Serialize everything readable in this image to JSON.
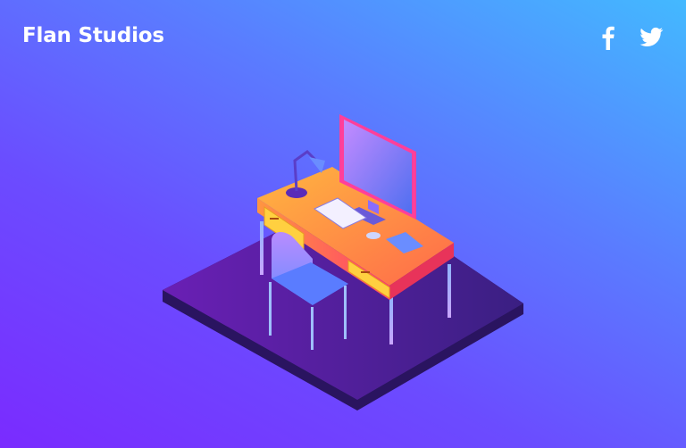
{
  "header": {
    "brand": "Flan Studios"
  },
  "social": [
    {
      "icon": "facebook-icon"
    },
    {
      "icon": "twitter-icon"
    }
  ],
  "colors": {
    "background_start": "#7a2bff",
    "background_end": "#43b9ff",
    "desk": "#ff8a3d",
    "platform": "#5a1fa8"
  }
}
